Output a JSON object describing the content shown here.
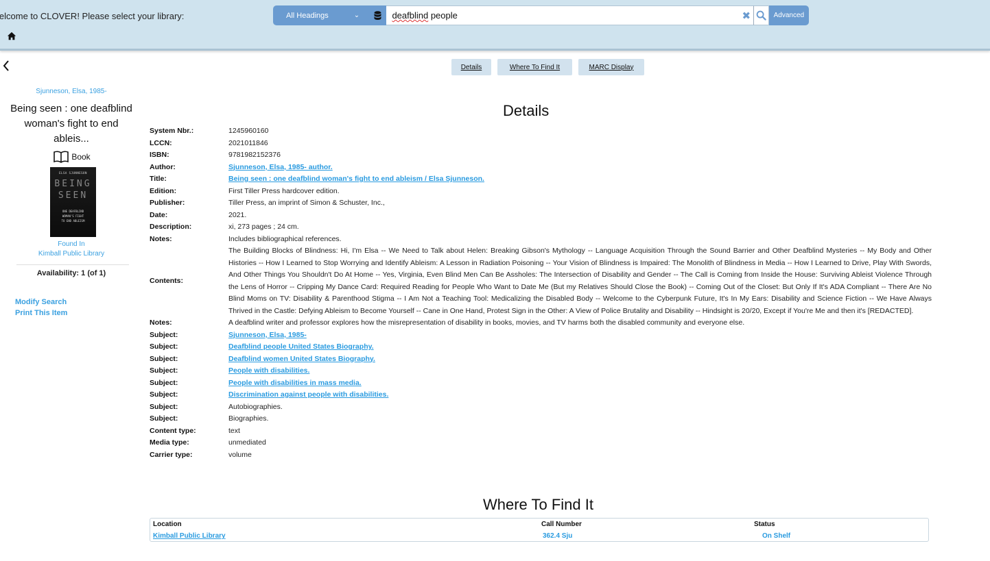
{
  "header": {
    "welcome": "lelcome to CLOVER! Please select your library:",
    "search_scope": "All Headings",
    "search_query_misspelled": "deafblind",
    "search_query_rest": " people",
    "advanced_label": "Advanced"
  },
  "tabs": [
    {
      "label": "Details"
    },
    {
      "label": "Where To Find It"
    },
    {
      "label": "MARC Display"
    }
  ],
  "sidebar": {
    "author": "Sjunneson, Elsa, 1985-",
    "title": "Being seen : one deafblind woman's fight to end ableis...",
    "format": "Book",
    "cover": {
      "author": "ELSA SJUNNESON",
      "title_line1": "BEING",
      "title_line2": "SEEN",
      "subtitle1": "ONE DEAFBLIND",
      "subtitle2": "WOMAN'S FIGHT",
      "subtitle3": "TO END ABLEISM"
    },
    "found_in_label": "Found In",
    "found_in_library": "Kimball Public Library",
    "availability": "Availability: 1 (of 1)",
    "modify_search": "Modify Search",
    "print_item": "Print This Item"
  },
  "details": {
    "heading": "Details",
    "rows": [
      {
        "label": "System Nbr.:",
        "value": "1245960160"
      },
      {
        "label": "LCCN:",
        "value": "2021011846"
      },
      {
        "label": "ISBN:",
        "value": "9781982152376"
      },
      {
        "label": "Author:",
        "value": "Sjunneson, Elsa, 1985- author."
      },
      {
        "label": "Title:",
        "value": "Being seen : one deafblind woman's fight to end ableism / Elsa Sjunneson."
      },
      {
        "label": "Edition:",
        "value": "First Tiller Press hardcover edition."
      },
      {
        "label": "Publisher:",
        "value": "Tiller Press, an imprint of Simon & Schuster, Inc.,"
      },
      {
        "label": "Date:",
        "value": "2021."
      },
      {
        "label": "Description:",
        "value": "xi, 273 pages ; 24 cm."
      },
      {
        "label": "Notes:",
        "value": "Includes bibliographical references."
      },
      {
        "label": "Contents:",
        "value": "The Building Blocks of Blindness: Hi, I'm Elsa -- We Need to Talk about Helen: Breaking Gibson's Mythology -- Language Acquisition Through the Sound Barrier and Other Deafblind Mysteries -- My Body and Other Histories -- How I Learned to Stop Worrying and Identify Ableism: A Lesson in Radiation Poisoning -- Your Vision of Blindness is Impaired: The Monolith of Blindness in Media -- How I Learned to Drive, Play With Swords, And Other Things You Shouldn't Do At Home -- Yes, Virginia, Even Blind Men Can Be Assholes: The Intersection of Disability and Gender -- The Call is Coming from Inside the House: Surviving Ableist Violence Through the Lens of Horror -- Cripping My Dance Card: Required Reading for People Who Want to Date Me (But my Relatives Should Close the Book) -- Coming Out of the Closet: But Only If It's ADA Compliant -- There Are No Blind Moms on TV: Disability & Parenthood Stigma -- I Am Not a Teaching Tool: Medicalizing the Disabled Body -- Welcome to the Cyberpunk Future, It's In My Ears: Disability and Science Fiction -- We Have Always Thrived in the Castle: Defying Ableism to Become Yourself -- Cane in One Hand, Protest Sign in the Other: A View of Police Brutality and Disability -- Hindsight is 20/20, Except if You're Me and then it's [REDACTED]."
      },
      {
        "label": "Notes:",
        "value": "A deafblind writer and professor explores how the misrepresentation of disability in books, movies, and TV harms both the disabled community and everyone else."
      },
      {
        "label": "Subject:",
        "value": "Sjunneson, Elsa, 1985-"
      },
      {
        "label": "Subject:",
        "value": "Deafblind people United States Biography."
      },
      {
        "label": "Subject:",
        "value": "Deafblind women United States Biography."
      },
      {
        "label": "Subject:",
        "value": "People with disabilities."
      },
      {
        "label": "Subject:",
        "value": "People with disabilities in mass media."
      },
      {
        "label": "Subject:",
        "value": "Discrimination against people with disabilities."
      },
      {
        "label": "Subject:",
        "value": "Autobiographies."
      },
      {
        "label": "Subject:",
        "value": "Biographies."
      },
      {
        "label": "Content type:",
        "value": "text"
      },
      {
        "label": "Media type:",
        "value": "unmediated"
      },
      {
        "label": "Carrier type:",
        "value": "volume"
      }
    ]
  },
  "where": {
    "heading": "Where To Find It",
    "columns": [
      "Location",
      "Call Number",
      "Status"
    ],
    "rows": [
      {
        "location": "Kimball Public Library",
        "call_number": "362.4 Sju",
        "status": "On Shelf"
      }
    ]
  },
  "colors": {
    "header_bg": "#cfe3ee",
    "accent": "#6a9bd0",
    "link": "#2a9be0"
  }
}
